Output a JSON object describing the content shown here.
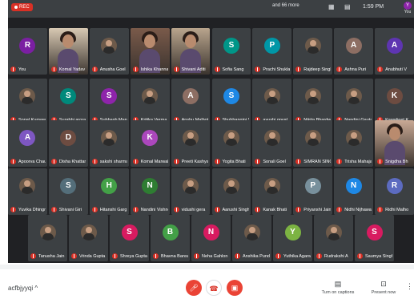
{
  "topbar": {
    "rec_label": "REC",
    "see_more": "and 66 more",
    "clock": "1:59 PM",
    "self_initial": "Y",
    "self_label": "You"
  },
  "rows": [
    [
      {
        "name": "You",
        "initial": "R",
        "color": "#7b1fa2",
        "type": "avatar"
      },
      {
        "name": "Komal Yadav",
        "type": "video",
        "color": "#d8c9b3"
      },
      {
        "name": "Anusha Goel",
        "type": "photo"
      },
      {
        "name": "Ishika Khanna",
        "type": "video",
        "color": "#7a5a4a"
      },
      {
        "name": "Shivani Aditi",
        "type": "video",
        "color": "#b9a58d"
      },
      {
        "name": "Sofia Sang",
        "initial": "S",
        "color": "#009688",
        "type": "avatar"
      },
      {
        "name": "Prachi Shukla",
        "initial": "P",
        "color": "#0097a7",
        "type": "avatar"
      },
      {
        "name": "Rajdeep Singh",
        "type": "photo"
      },
      {
        "name": "Ashna Puri",
        "initial": "A",
        "color": "#8d6e63",
        "type": "avatar"
      },
      {
        "name": "Anubhuti V",
        "initial": "A",
        "color": "#5e35b1",
        "type": "avatar"
      }
    ],
    [
      {
        "name": "Sonal Kumawat",
        "type": "photo"
      },
      {
        "name": "Surabhi arora",
        "initial": "S",
        "color": "#00897b",
        "type": "avatar"
      },
      {
        "name": "Subhash Manda",
        "initial": "S",
        "color": "#8e24aa",
        "type": "avatar"
      },
      {
        "name": "Kritika Verma",
        "type": "photo"
      },
      {
        "name": "Anshu Malhotra",
        "initial": "A",
        "color": "#8d6e63",
        "type": "avatar"
      },
      {
        "name": "Shubhangini S...",
        "initial": "S",
        "color": "#1e88e5",
        "type": "avatar"
      },
      {
        "name": "ayushi goyal",
        "type": "photo"
      },
      {
        "name": "Nikita Bhardwaj",
        "type": "photo"
      },
      {
        "name": "Nandini Gautam",
        "type": "photo"
      },
      {
        "name": "Kawaljeet K",
        "initial": "K",
        "color": "#6d4c41",
        "type": "avatar"
      }
    ],
    [
      {
        "name": "Apoorva Chau...",
        "initial": "A",
        "color": "#7e57c2",
        "type": "avatar"
      },
      {
        "name": "Disha Khattar",
        "initial": "D",
        "color": "#6d4c41",
        "type": "avatar"
      },
      {
        "name": "sakshi sharma",
        "type": "photo"
      },
      {
        "name": "Komal Marwah",
        "initial": "K",
        "color": "#ab47bc",
        "type": "avatar"
      },
      {
        "name": "Preeti Kashyap",
        "type": "photo"
      },
      {
        "name": "Yogita Bhati",
        "type": "photo"
      },
      {
        "name": "Sonali Goel",
        "type": "photo"
      },
      {
        "name": "SIMRAN SINGH",
        "type": "photo"
      },
      {
        "name": "Trisha Mahajan",
        "type": "photo"
      },
      {
        "name": "Snigdha Bh",
        "type": "video",
        "color": "#c9a995"
      }
    ],
    [
      {
        "name": "Yuvika Dhingra",
        "type": "photo"
      },
      {
        "name": "Shivani Giri",
        "initial": "S",
        "color": "#546e7a",
        "type": "avatar"
      },
      {
        "name": "Hitanshi Garg",
        "initial": "H",
        "color": "#43a047",
        "type": "avatar"
      },
      {
        "name": "Nandini Vishnoi",
        "initial": "N",
        "color": "#2e7d32",
        "type": "avatar"
      },
      {
        "name": "vidushi gera",
        "type": "photo"
      },
      {
        "name": "Aarushi Singh",
        "type": "photo"
      },
      {
        "name": "Kanak Bhati",
        "type": "photo"
      },
      {
        "name": "Priyanshi Jain",
        "initial": "P",
        "color": "#78909c",
        "type": "avatar"
      },
      {
        "name": "Nidhi Nijhawan",
        "initial": "N",
        "color": "#1e88e5",
        "type": "avatar"
      },
      {
        "name": "Ridhi Malho",
        "initial": "R",
        "color": "#5c6bc0",
        "type": "avatar"
      }
    ],
    [
      {
        "name": "Tanusha Jain",
        "type": "photo"
      },
      {
        "name": "Vrinda Gupta",
        "type": "photo"
      },
      {
        "name": "Shreya Gupta ...",
        "initial": "S",
        "color": "#d81b60",
        "type": "avatar"
      },
      {
        "name": "Bhavna Bansal",
        "initial": "B",
        "color": "#43a047",
        "type": "avatar"
      },
      {
        "name": "Neha Gahlon",
        "initial": "N",
        "color": "#d81b60",
        "type": "avatar"
      },
      {
        "name": "Anshika Pundir",
        "type": "photo"
      },
      {
        "name": "Yuthika Agarwal",
        "initial": "Y",
        "color": "#7cb342",
        "type": "avatar"
      },
      {
        "name": "Rudrakshi A",
        "type": "photo"
      },
      {
        "name": "Saumya Singh",
        "initial": "S",
        "color": "#d81b60",
        "type": "avatar"
      }
    ]
  ],
  "bottombar": {
    "meeting_code": "acfbjyyqi",
    "captions_label": "Turn on captions",
    "present_label": "Present now"
  }
}
